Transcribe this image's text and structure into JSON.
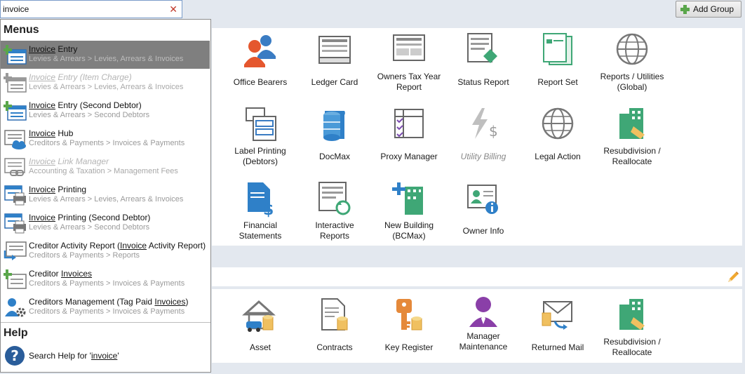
{
  "search": {
    "value": "invoice",
    "clear_icon": "close-icon"
  },
  "toolbar": {
    "add_group_label": "Add Group"
  },
  "dropdown": {
    "menus_heading": "Menus",
    "items": [
      {
        "pre": "",
        "match": "Invoice",
        "post": " Entry",
        "path": "Levies & Arrears > Levies, Arrears & Invoices",
        "icon": "invoice-add-icon"
      },
      {
        "pre": "",
        "match": "Invoice",
        "post": " Entry (Item Charge)",
        "path": "Levies & Arrears > Levies, Arrears & Invoices",
        "icon": "invoice-add-icon"
      },
      {
        "pre": "",
        "match": "Invoice",
        "post": " Entry (Second Debtor)",
        "path": "Levies & Arrears > Second Debtors",
        "icon": "invoice-add-icon"
      },
      {
        "pre": "",
        "match": "Invoice",
        "post": " Hub",
        "path": "Creditors & Payments > Invoices & Payments",
        "icon": "invoice-cloud-icon"
      },
      {
        "pre": "",
        "match": "Invoice",
        "post": " Link Manager",
        "path": "Accounting & Taxation > Management Fees",
        "icon": "invoice-link-icon"
      },
      {
        "pre": "",
        "match": "Invoice",
        "post": " Printing",
        "path": "Levies & Arrears > Levies, Arrears & Invoices",
        "icon": "invoice-print-icon"
      },
      {
        "pre": "",
        "match": "Invoice",
        "post": " Printing (Second Debtor)",
        "path": "Levies & Arrears > Second Debtors",
        "icon": "invoice-print-icon"
      },
      {
        "pre": "Creditor Activity Report (",
        "match": "Invoice",
        "post": " Activity Report)",
        "path": "Creditors & Payments > Reports",
        "icon": "report-arrow-icon"
      },
      {
        "pre": "Creditor ",
        "match": "Invoices",
        "post": "",
        "path": "Creditors & Payments > Invoices & Payments",
        "icon": "invoice-add-icon"
      },
      {
        "pre": "Creditors Management (Tag Paid ",
        "match": "Invoices",
        "post": ")",
        "path": "Creditors & Payments > Invoices & Payments",
        "icon": "person-gear-icon"
      }
    ],
    "help_heading": "Help",
    "help_pre": "Search Help for '",
    "help_match": "invoice",
    "help_post": "'"
  },
  "tiles_group1": [
    {
      "label": "Office Bearers",
      "icon": "people-icon"
    },
    {
      "label": "Ledger Card",
      "icon": "ledger-card-icon"
    },
    {
      "label": "Owners Tax Year\nReport",
      "icon": "tax-report-icon"
    },
    {
      "label": "Status Report",
      "icon": "status-report-icon"
    },
    {
      "label": "Report Set",
      "icon": "report-set-icon"
    },
    {
      "label": "Reports / Utilities\n(Global)",
      "icon": "globe-icon"
    },
    {
      "label": "Label Printing\n(Debtors)",
      "icon": "label-printing-icon"
    },
    {
      "label": "DocMax",
      "icon": "docmax-icon"
    },
    {
      "label": "Proxy Manager",
      "icon": "proxy-manager-icon"
    },
    {
      "label": "Utility Billing",
      "icon": "utility-billing-icon"
    },
    {
      "label": "Legal Action",
      "icon": "globe-icon"
    },
    {
      "label": "Resubdivision /\nReallocate",
      "icon": "building-icon"
    },
    {
      "label": "Financial\nStatements",
      "icon": "financial-statements-icon"
    },
    {
      "label": "Interactive\nReports",
      "icon": "interactive-reports-icon"
    },
    {
      "label": "New Building\n(BCMax)",
      "icon": "new-building-icon"
    },
    {
      "label": "Owner Info",
      "icon": "owner-info-icon"
    }
  ],
  "tiles_group2": [
    {
      "label": "Asset",
      "icon": "asset-icon"
    },
    {
      "label": "Contracts",
      "icon": "contracts-icon"
    },
    {
      "label": "Key Register",
      "icon": "key-icon"
    },
    {
      "label": "Manager\nMaintenance",
      "icon": "manager-icon"
    },
    {
      "label": "Returned Mail",
      "icon": "returned-mail-icon"
    },
    {
      "label": "Resubdivision /\nReallocate",
      "icon": "building-icon"
    }
  ],
  "colors": {
    "selected_row": "#7f7f7f",
    "accent_blue": "#3a7cc3",
    "accent_green": "#5aa64b",
    "accent_orange": "#e5893a"
  }
}
